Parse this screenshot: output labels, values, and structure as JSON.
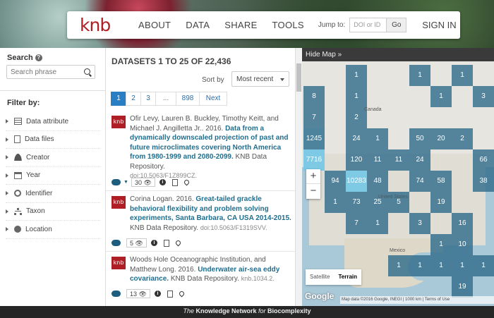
{
  "header": {
    "logo": "knb",
    "nav": [
      "ABOUT",
      "DATA",
      "SHARE",
      "TOOLS"
    ],
    "jump_label": "Jump to:",
    "jump_placeholder": "DOI or ID",
    "go": "Go",
    "sign_in": "SIGN IN"
  },
  "sidebar": {
    "search_title": "Search",
    "search_placeholder": "Search phrase",
    "filter_title": "Filter by:",
    "filters": [
      {
        "label": "Data attribute",
        "icon": "table-icon"
      },
      {
        "label": "Data files",
        "icon": "file-icon"
      },
      {
        "label": "Creator",
        "icon": "user-icon"
      },
      {
        "label": "Year",
        "icon": "calendar-icon"
      },
      {
        "label": "Identifier",
        "icon": "id-icon"
      },
      {
        "label": "Taxon",
        "icon": "sitemap-icon"
      },
      {
        "label": "Location",
        "icon": "globe-icon"
      }
    ]
  },
  "results": {
    "title": "DATASETS 1 TO 25 OF 22,436",
    "sort_label": "Sort by",
    "sort_value": "Most recent",
    "pages": [
      "1",
      "2",
      "3",
      "...",
      "898",
      "Next"
    ],
    "records": [
      {
        "badge": "knb",
        "authors": "Ofir Levy, Lauren B. Buckley, Timothy Keitt, and Michael J. Angilletta Jr.. 2016.",
        "title": "Data from a dynamically downscaled projection of past and future microclimates covering North America from 1980-1999 and 2080-2099.",
        "repo": "KNB Data Repository.",
        "doi": "doi:10.5063/F1Z899CZ.",
        "views": "30"
      },
      {
        "badge": "knb",
        "authors": "Corina Logan. 2016.",
        "title": "Great-tailed grackle behavioral flexibility and problem solving experiments, Santa Barbara, CA USA 2014-2015.",
        "repo": "KNB Data Repository.",
        "doi": "doi:10.5063/F1319SVV.",
        "views": "5"
      },
      {
        "badge": "knb",
        "authors": "Woods Hole Oceanographic Institution, and Matthew Long. 2016.",
        "title": "Underwater air-sea eddy covariance.",
        "repo": "KNB Data Repository.",
        "doi": "knb.1034.2.",
        "views": "13"
      }
    ]
  },
  "map": {
    "hide_label": "Hide Map »",
    "cells": [
      "1",
      "1",
      "1",
      "8",
      "1",
      "1",
      "3",
      "7",
      "2",
      "1245",
      "24",
      "1",
      "50",
      "20",
      "2",
      "7716",
      "120",
      "11",
      "11",
      "24",
      "66",
      "94",
      "10283",
      "48",
      "74",
      "58",
      "38",
      "1",
      "73",
      "25",
      "5",
      "19",
      "7",
      "1",
      "3",
      "16",
      "1",
      "10",
      "1",
      "1",
      "1",
      "1",
      "1",
      "19"
    ],
    "place_labels": [
      "Canada",
      "United States",
      "Mexico"
    ],
    "zoom_in": "+",
    "zoom_out": "−",
    "map_types": [
      "Satellite",
      "Terrain"
    ],
    "google": "Google",
    "attribution": "Map data ©2016 Google, INEGI | 1000 km | Terms of Use"
  },
  "footer": {
    "pre": "The",
    "mid": " Knowledge Network ",
    "for": "for",
    "post": " Biocomplexity"
  }
}
